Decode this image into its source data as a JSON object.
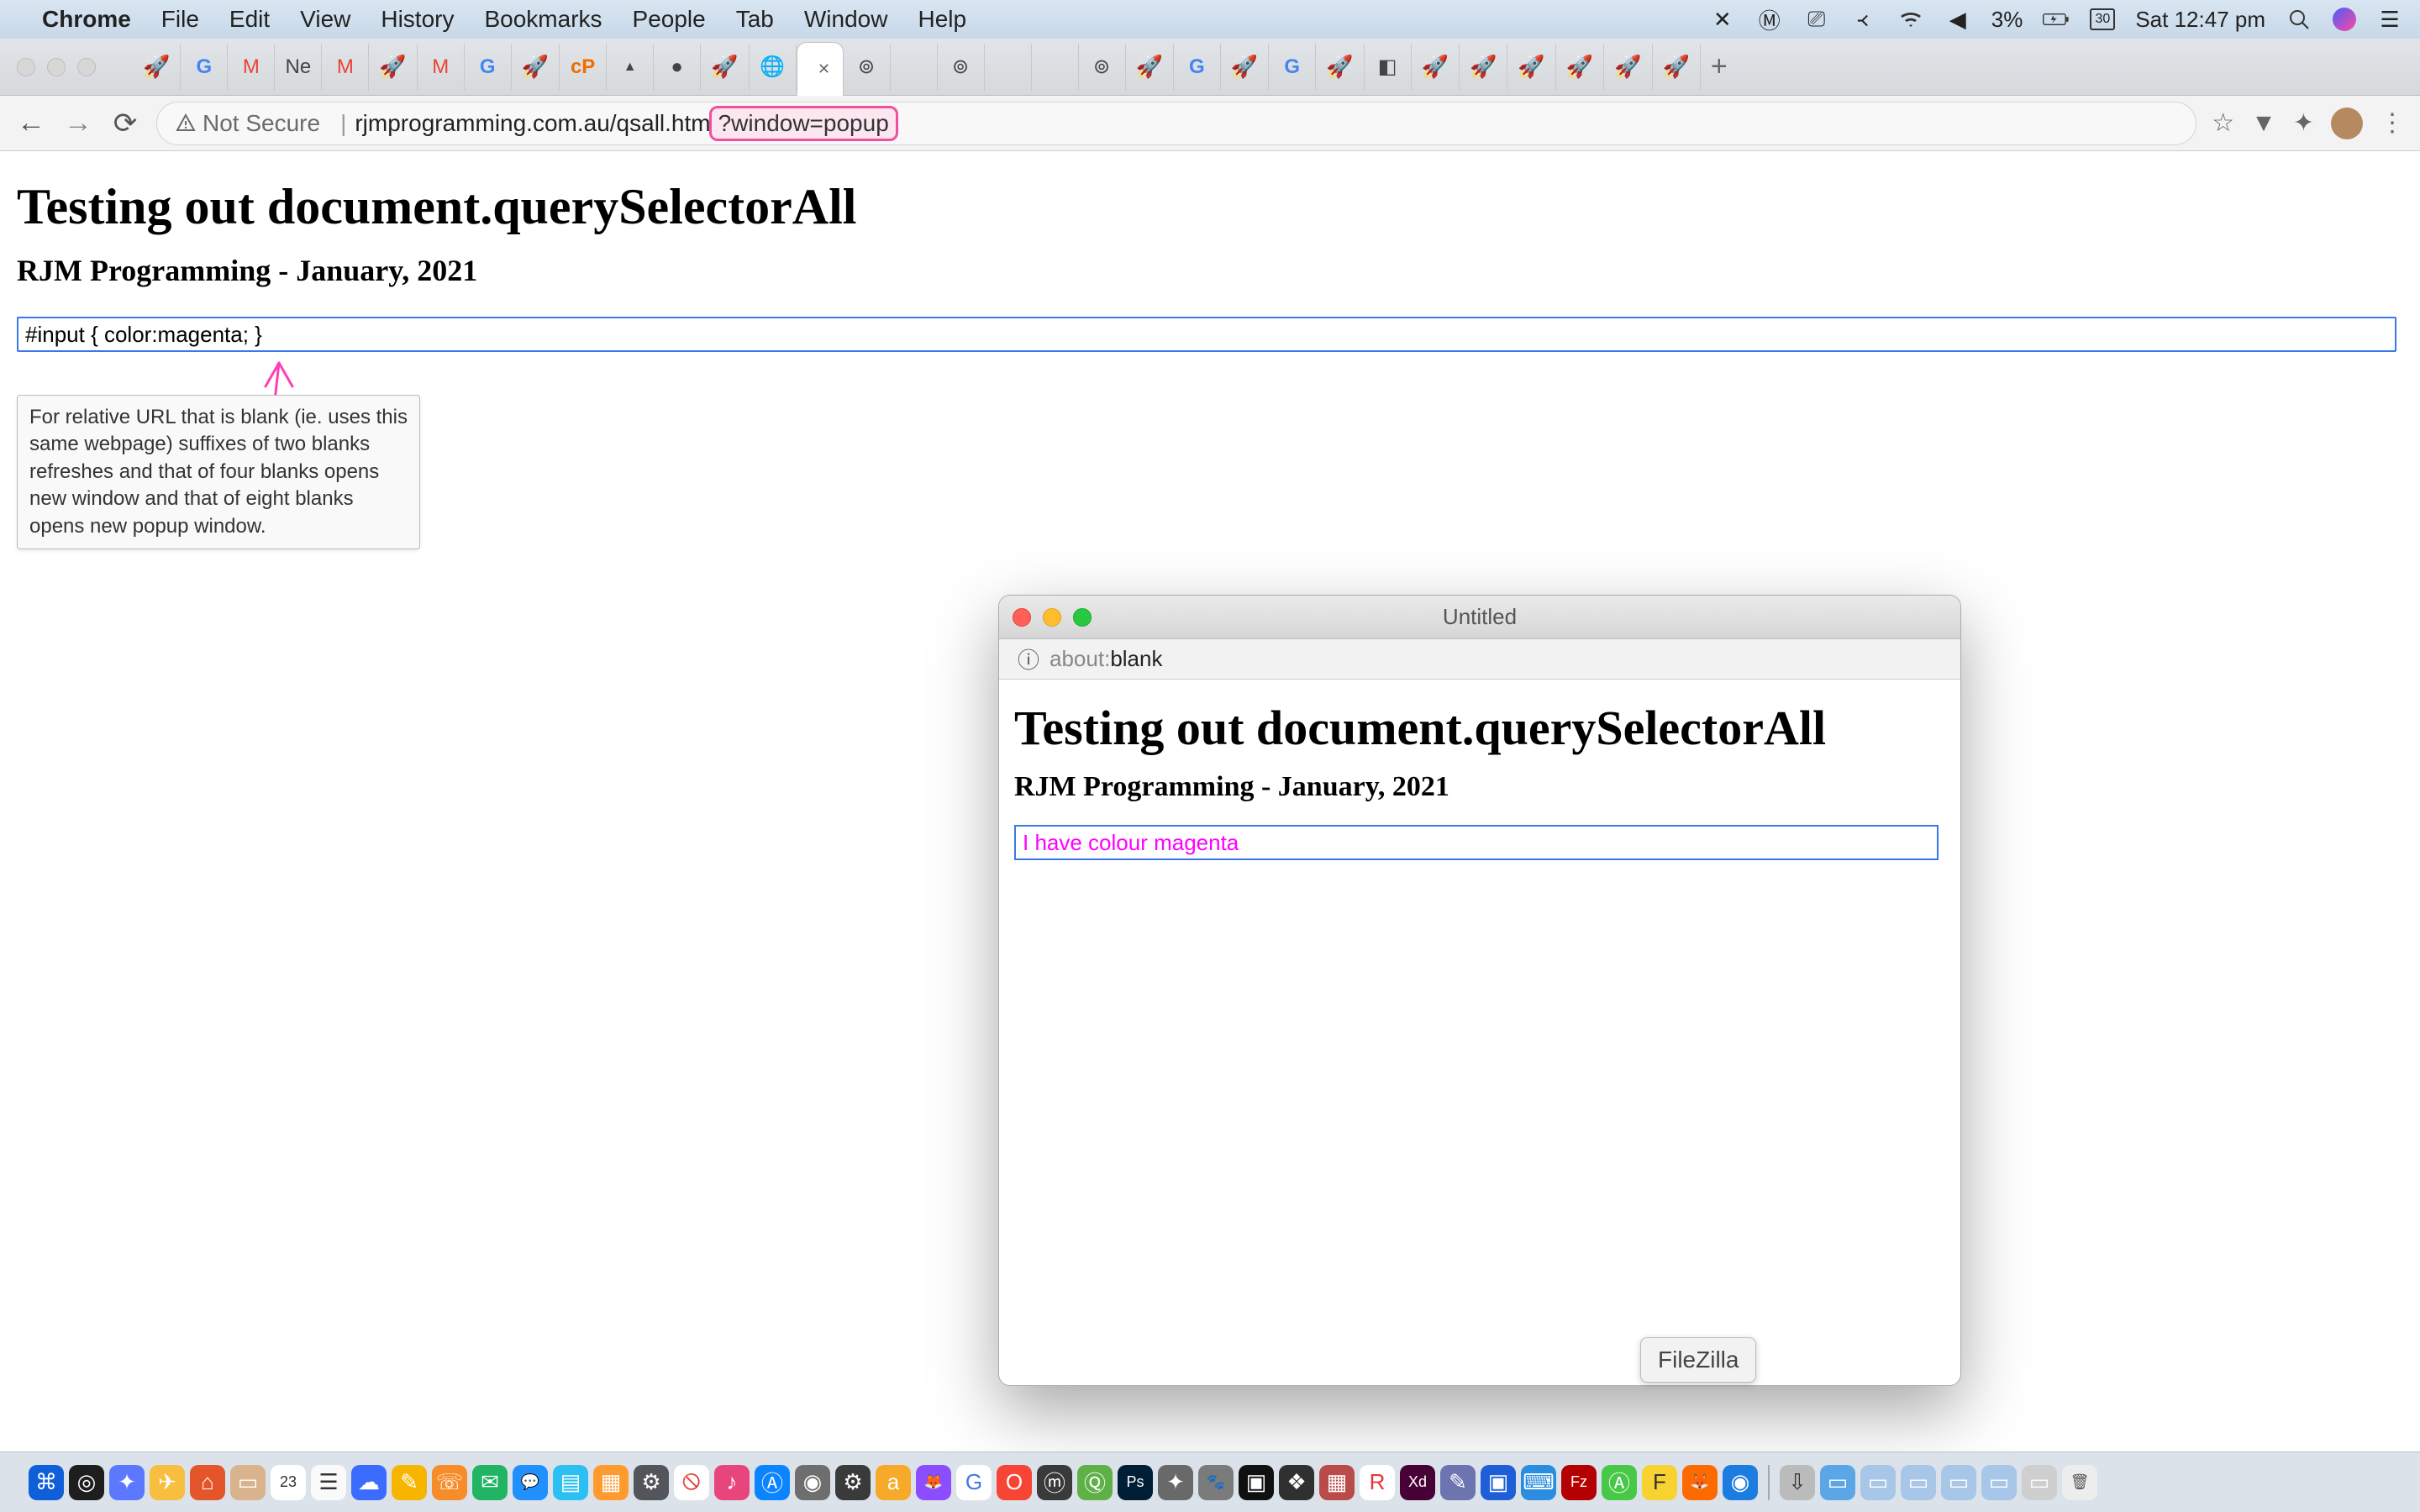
{
  "menubar": {
    "app": "Chrome",
    "items": [
      "File",
      "Edit",
      "View",
      "History",
      "Bookmarks",
      "People",
      "Tab",
      "Window",
      "Help"
    ],
    "battery": "3%",
    "date_cal": "30",
    "clock": "Sat 12:47 pm"
  },
  "browser": {
    "not_secure": "Not Secure",
    "url_plain": "rjmprogramming.com.au/qsall.htm",
    "url_highlight": "?window=popup"
  },
  "page": {
    "h1": "Testing out document.querySelectorAll",
    "h3": "RJM Programming - January, 2021",
    "input_value": "#input { color:magenta; }",
    "tooltip": "For relative URL that is blank (ie. uses this same webpage) suffixes of two blanks refreshes and that of four blanks opens new window and that of eight blanks opens new popup window."
  },
  "popup": {
    "title": "Untitled",
    "url_label": "about:",
    "url_value": "blank",
    "h1": "Testing out document.querySelectorAll",
    "h3": "RJM Programming - January, 2021",
    "input_value": "I have colour magenta"
  },
  "dock": {
    "tooltip": "FileZilla",
    "badge_calendar": "23"
  },
  "tabs": [
    "Ne"
  ],
  "dock_apps": [
    {
      "bg": "#0e5fd8",
      "glyph": "⌘"
    },
    {
      "bg": "#1e1e1e",
      "glyph": "◎"
    },
    {
      "bg": "#5c78ff",
      "glyph": "✦"
    },
    {
      "bg": "#f8be3f",
      "glyph": "✈"
    },
    {
      "bg": "#e4562a",
      "glyph": "⌂"
    },
    {
      "bg": "#d9b38c",
      "glyph": "▭"
    },
    {
      "bg": "#ffffff",
      "glyph": "23",
      "text": "#333"
    },
    {
      "bg": "#fafafa",
      "glyph": "☰",
      "text": "#333"
    },
    {
      "bg": "#3c6cff",
      "glyph": "☁"
    },
    {
      "bg": "#f8b500",
      "glyph": "✎"
    },
    {
      "bg": "#f78c2a",
      "glyph": "☏"
    },
    {
      "bg": "#20b463",
      "glyph": "✉"
    },
    {
      "bg": "#2090ff",
      "glyph": "💬"
    },
    {
      "bg": "#2bc0f1",
      "glyph": "▤"
    },
    {
      "bg": "#ff9a2e",
      "glyph": "▦"
    },
    {
      "bg": "#54555a",
      "glyph": "⚙"
    },
    {
      "bg": "#ffffff",
      "glyph": "🚫",
      "text": "#e33"
    },
    {
      "bg": "#e8457c",
      "glyph": "♪"
    },
    {
      "bg": "#0a84ff",
      "glyph": "Ⓐ"
    },
    {
      "bg": "#6e6e6e",
      "glyph": "◉"
    },
    {
      "bg": "#3a3a3a",
      "glyph": "⚙"
    },
    {
      "bg": "#f7a92a",
      "glyph": "a"
    },
    {
      "bg": "#8c4cff",
      "glyph": "🦊"
    },
    {
      "bg": "#ffffff",
      "glyph": "G",
      "text": "#3c78e7"
    },
    {
      "bg": "#f74434",
      "glyph": "O"
    },
    {
      "bg": "#3a3a3a",
      "glyph": "ⓜ"
    },
    {
      "bg": "#5eb047",
      "glyph": "Ⓠ"
    },
    {
      "bg": "#001e36",
      "glyph": "Ps"
    },
    {
      "bg": "#696969",
      "glyph": "✦"
    },
    {
      "bg": "#7b7b7b",
      "glyph": "🐾"
    },
    {
      "bg": "#101010",
      "glyph": "▣"
    },
    {
      "bg": "#303030",
      "glyph": "❖"
    },
    {
      "bg": "#b94b4b",
      "glyph": "▦"
    },
    {
      "bg": "#ffffff",
      "glyph": "R",
      "text": "#e33"
    },
    {
      "bg": "#470137",
      "glyph": "Xd"
    },
    {
      "bg": "#6d74b0",
      "glyph": "✎"
    },
    {
      "bg": "#1e5fd8",
      "glyph": "▣"
    },
    {
      "bg": "#2a8de0",
      "glyph": "⌨"
    },
    {
      "bg": "#b40000",
      "glyph": "Fz"
    },
    {
      "bg": "#47c847",
      "glyph": "Ⓐ"
    },
    {
      "bg": "#f8d230",
      "glyph": "F",
      "text": "#333"
    },
    {
      "bg": "#ff6a00",
      "glyph": "🦊"
    },
    {
      "bg": "#1d7ce0",
      "glyph": "◉"
    },
    {
      "bg": "#bbbbbb",
      "glyph": "⇩",
      "text": "#333"
    },
    {
      "bg": "#5aa6e6",
      "glyph": "▭"
    },
    {
      "bg": "#a8c6e8",
      "glyph": "▭"
    },
    {
      "bg": "#a8c6e8",
      "glyph": "▭"
    },
    {
      "bg": "#a8c6e8",
      "glyph": "▭"
    },
    {
      "bg": "#a8c6e8",
      "glyph": "▭"
    },
    {
      "bg": "#cfcfcf",
      "glyph": "▭"
    },
    {
      "bg": "#ededed",
      "glyph": "🗑",
      "text": "#555"
    }
  ]
}
